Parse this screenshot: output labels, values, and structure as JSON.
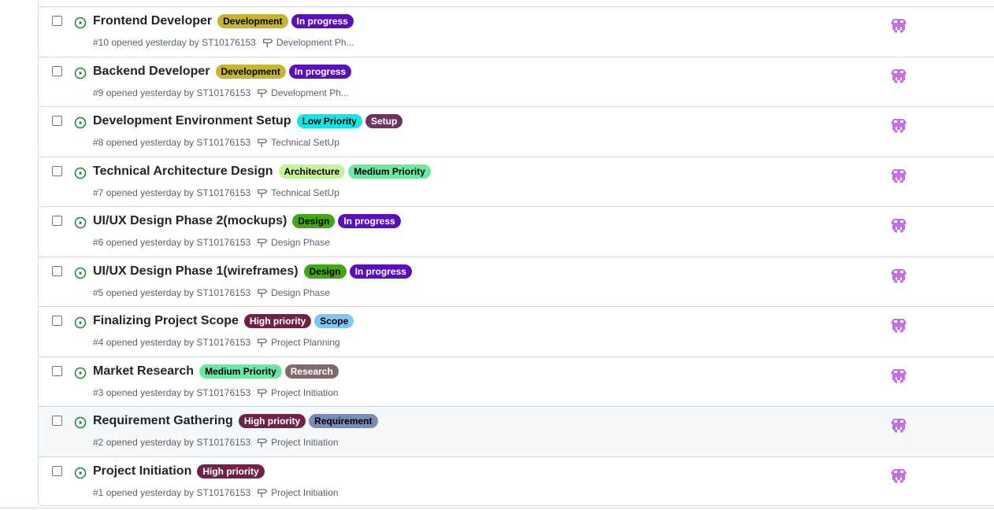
{
  "colors": {
    "open_icon": "#1a7f37",
    "avatar": "#c46ee8"
  },
  "issues": [
    {
      "title": "Frontend Developer",
      "labels": [
        {
          "text": "Development",
          "bg": "#c6b432",
          "fg": "#000000"
        },
        {
          "text": "In progress",
          "bg": "#5a10b8",
          "fg": "#ffffff"
        }
      ],
      "number": "#10",
      "opened_text": "opened yesterday by ST10176153",
      "milestone": "Development Ph...",
      "icon": "issue-opened-icon",
      "hover": false
    },
    {
      "title": "Backend Developer",
      "labels": [
        {
          "text": "Development",
          "bg": "#c6b432",
          "fg": "#000000"
        },
        {
          "text": "In progress",
          "bg": "#5a10b8",
          "fg": "#ffffff"
        }
      ],
      "number": "#9",
      "opened_text": "opened yesterday by ST10176153",
      "milestone": "Development Ph...",
      "icon": "issue-opened-icon",
      "hover": false
    },
    {
      "title": "Development Environment Setup",
      "labels": [
        {
          "text": "Low Priority",
          "bg": "#10e8e8",
          "fg": "#000000"
        },
        {
          "text": "Setup",
          "bg": "#6e3360",
          "fg": "#ffffff"
        }
      ],
      "number": "#8",
      "opened_text": "opened yesterday by ST10176153",
      "milestone": "Technical SetUp",
      "icon": "issue-opened-icon",
      "hover": false
    },
    {
      "title": "Technical Architecture Design",
      "labels": [
        {
          "text": "Architecture",
          "bg": "#c6f2a0",
          "fg": "#000000"
        },
        {
          "text": "Medium Priority",
          "bg": "#6ce8a0",
          "fg": "#000000"
        }
      ],
      "number": "#7",
      "opened_text": "opened yesterday by ST10176153",
      "milestone": "Technical SetUp",
      "icon": "issue-opened-icon",
      "hover": false
    },
    {
      "title": "UI/UX Design Phase 2(mockups)",
      "labels": [
        {
          "text": "Design",
          "bg": "#42a812",
          "fg": "#000000"
        },
        {
          "text": "In progress",
          "bg": "#5a10b8",
          "fg": "#ffffff"
        }
      ],
      "number": "#6",
      "opened_text": "opened yesterday by ST10176153",
      "milestone": "Design Phase",
      "icon": "issue-opened-icon",
      "hover": false
    },
    {
      "title": "UI/UX Design Phase 1(wireframes)",
      "labels": [
        {
          "text": "Design",
          "bg": "#42a812",
          "fg": "#000000"
        },
        {
          "text": "In progress",
          "bg": "#5a10b8",
          "fg": "#ffffff"
        }
      ],
      "number": "#5",
      "opened_text": "opened yesterday by ST10176153",
      "milestone": "Design Phase",
      "icon": "issue-opened-icon",
      "hover": false
    },
    {
      "title": "Finalizing Project Scope",
      "labels": [
        {
          "text": "High priority",
          "bg": "#6e2245",
          "fg": "#ffffff"
        },
        {
          "text": "Scope",
          "bg": "#80c6f2",
          "fg": "#000000"
        }
      ],
      "number": "#4",
      "opened_text": "opened yesterday by ST10176153",
      "milestone": "Project Planning",
      "icon": "issue-opened-icon",
      "hover": false
    },
    {
      "title": "Market Research",
      "labels": [
        {
          "text": "Medium Priority",
          "bg": "#6ce8a0",
          "fg": "#000000"
        },
        {
          "text": "Research",
          "bg": "#806a6a",
          "fg": "#ffffff"
        }
      ],
      "number": "#3",
      "opened_text": "opened yesterday by ST10176153",
      "milestone": "Project Initiation",
      "icon": "issue-opened-icon",
      "hover": false
    },
    {
      "title": "Requirement Gathering",
      "labels": [
        {
          "text": "High priority",
          "bg": "#6e2245",
          "fg": "#ffffff"
        },
        {
          "text": "Requirement",
          "bg": "#7a8cb8",
          "fg": "#000000"
        }
      ],
      "number": "#2",
      "opened_text": "opened yesterday by ST10176153",
      "milestone": "Project Initiation",
      "icon": "issue-opened-icon",
      "hover": true
    },
    {
      "title": "Project Initiation",
      "labels": [
        {
          "text": "High priority",
          "bg": "#6e2245",
          "fg": "#ffffff"
        }
      ],
      "number": "#1",
      "opened_text": "opened yesterday by ST10176153",
      "milestone": "Project Initiation",
      "icon": "issue-opened-icon",
      "hover": false
    }
  ]
}
